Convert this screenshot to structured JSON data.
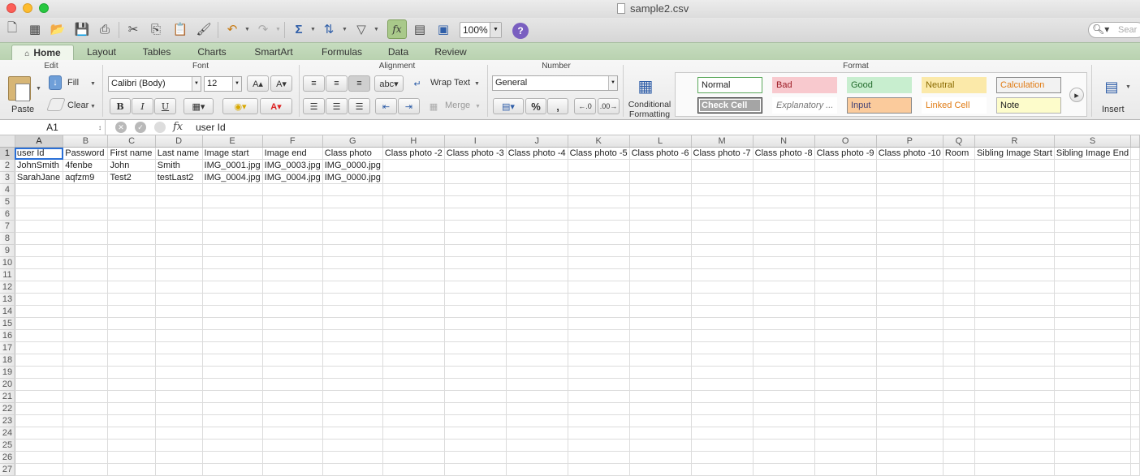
{
  "window": {
    "title": "sample2.csv"
  },
  "toolbar": {
    "zoom": "100%",
    "help_label": "?",
    "search_placeholder": "Sear"
  },
  "ribbon_tabs": [
    "Home",
    "Layout",
    "Tables",
    "Charts",
    "SmartArt",
    "Formulas",
    "Data",
    "Review"
  ],
  "ribbon": {
    "groups": {
      "edit": "Edit",
      "font": "Font",
      "alignment": "Alignment",
      "number": "Number",
      "format": "Format"
    },
    "paste_label": "Paste",
    "fill_label": "Fill",
    "clear_label": "Clear",
    "font_name": "Calibri (Body)",
    "font_size": "12",
    "bold": "B",
    "italic": "I",
    "underline": "U",
    "wrap_text_label": "Wrap Text",
    "merge_label": "Merge",
    "number_format": "General",
    "percent_label": "%",
    "comma_label": ",",
    "conditional_formatting_label": "Conditional Formatting",
    "styles": [
      {
        "label": "Normal",
        "bg": "#ffffff",
        "border": "#5aa85a",
        "color": "#222222"
      },
      {
        "label": "Bad",
        "bg": "#f8c9ce",
        "border": "#f8c9ce",
        "color": "#9c1c25"
      },
      {
        "label": "Good",
        "bg": "#c8eecf",
        "border": "#c8eecf",
        "color": "#226b2c"
      },
      {
        "label": "Neutral",
        "bg": "#fbe9a9",
        "border": "#fbe9a9",
        "color": "#8a6a00"
      },
      {
        "label": "Calculation",
        "bg": "#f2f2f2",
        "border": "#8a8a8a",
        "color": "#e07a12"
      },
      {
        "label": "Check Cell",
        "bg": "#a5a5a5",
        "border": "#3f3f3f",
        "color": "#ffffff"
      },
      {
        "label": "Explanatory ...",
        "bg": "#ffffff",
        "border": "#ffffff",
        "color": "#777777"
      },
      {
        "label": "Input",
        "bg": "#fbcb9c",
        "border": "#8a8a8a",
        "color": "#3f3f76"
      },
      {
        "label": "Linked Cell",
        "bg": "#ffffff",
        "border": "#ffffff",
        "color": "#e07a12"
      },
      {
        "label": "Note",
        "bg": "#fdfccb",
        "border": "#b2b2b2",
        "color": "#222222"
      }
    ],
    "insert_label": "Insert"
  },
  "formula_bar": {
    "cell_ref": "A1",
    "fx": "fx",
    "content": "user Id"
  },
  "sheet": {
    "columns": [
      "A",
      "B",
      "C",
      "D",
      "E",
      "F",
      "G",
      "H",
      "I",
      "J",
      "K",
      "L",
      "M",
      "N",
      "O",
      "P",
      "Q",
      "R",
      "S"
    ],
    "selected_column": "A",
    "selected_row": 1,
    "rows": [
      [
        "user Id",
        "Password",
        "First name",
        "Last name",
        "Image start",
        "Image end",
        "Class photo",
        "Class photo -2",
        "Class photo -3",
        "Class photo -4",
        "Class photo -5",
        "Class photo -6",
        "Class photo -7",
        "Class photo -8",
        "Class photo -9",
        "Class photo -10",
        "Room",
        "Sibling Image Start",
        "Sibling Image End"
      ],
      [
        "JohnSmith",
        "4fenbe",
        "John",
        "Smith",
        "IMG_0001.jpg",
        "IMG_0003.jpg",
        "IMG_0000.jpg",
        "",
        "",
        "",
        "",
        "",
        "",
        "",
        "",
        "",
        "",
        "",
        ""
      ],
      [
        "SarahJane",
        "aqfzm9",
        "Test2",
        "testLast2",
        "IMG_0004.jpg",
        "IMG_0004.jpg",
        "IMG_0000.jpg",
        "",
        "",
        "",
        "",
        "",
        "",
        "",
        "",
        "",
        "",
        "",
        ""
      ]
    ],
    "row_count": 27
  }
}
